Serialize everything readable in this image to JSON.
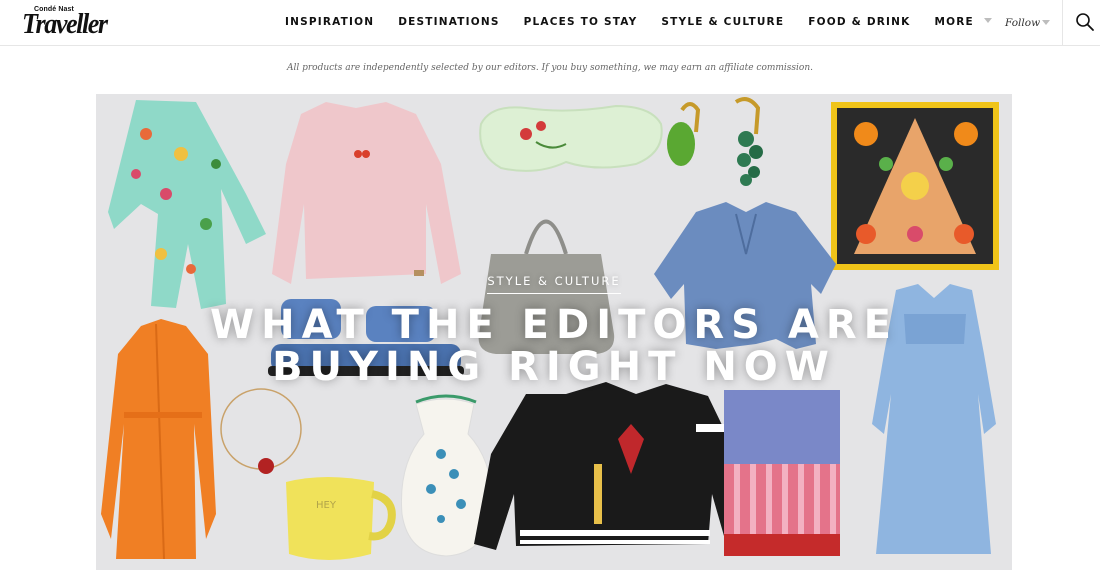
{
  "brand": {
    "logo_small": "Condé Nast",
    "logo_big": "Traveller"
  },
  "nav": {
    "items": [
      "INSPIRATION",
      "DESTINATIONS",
      "PLACES TO STAY",
      "STYLE & CULTURE",
      "FOOD & DRINK",
      "MORE"
    ]
  },
  "header": {
    "follow_label": "Follow",
    "search_icon": "search-icon"
  },
  "disclaimer": "All products are independently selected by our editors. If you buy something, we may earn an affiliate commission.",
  "hero": {
    "kicker": "STYLE & CULTURE",
    "headline_line1": "WHAT THE EDITORS ARE",
    "headline_line2": "BUYING RIGHT NOW",
    "mug_text": "HEY"
  },
  "colors": {
    "hero_bg": "#e4e4e6",
    "text": "#111111",
    "divider": "#e6e6e6"
  }
}
